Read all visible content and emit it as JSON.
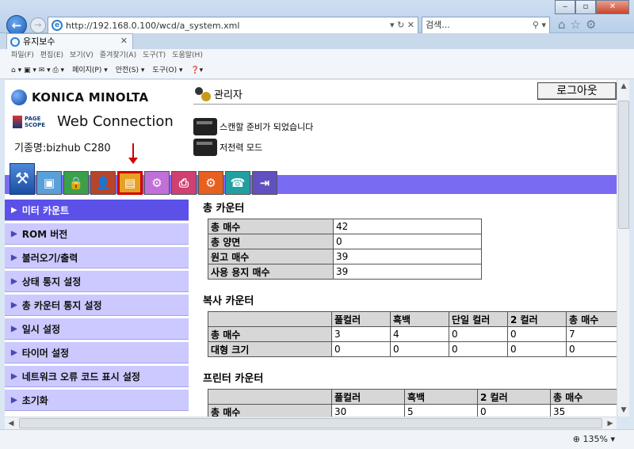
{
  "browser": {
    "url": "http://192.168.0.100/wcd/a_system.xml",
    "search_placeholder": "검색...",
    "tab_title": "유지보수",
    "menus": [
      "파일(F)",
      "편집(E)",
      "보기(V)",
      "즐겨찾기(A)",
      "도구(T)",
      "도움말(H)"
    ],
    "commands": [
      "페이지(P) ▾",
      "안전(S) ▾",
      "도구(O) ▾"
    ],
    "zoom": "135%"
  },
  "header": {
    "brand": "KONICA MINOLTA",
    "product_badge_top": "PAGE",
    "product_badge_bottom": "SCOPE",
    "product": "Web Connection",
    "model": "기종명:bizhub C280",
    "user": "관리자",
    "logout": "로그아웃",
    "status_scan": "스캔할 준비가 되었습니다",
    "status_power": "저전력 모드"
  },
  "icon_tabs": [
    {
      "name": "box",
      "color": "#5aa0d8",
      "glyph": "▣"
    },
    {
      "name": "security",
      "color": "#3aa04a",
      "glyph": "🔒"
    },
    {
      "name": "user-auth",
      "color": "#b8442a",
      "glyph": "👤"
    },
    {
      "name": "maintenance",
      "color": "#e8a020",
      "glyph": "▤"
    },
    {
      "name": "system-settings",
      "color": "#c070d8",
      "glyph": "⚙"
    },
    {
      "name": "print-settings",
      "color": "#d04070",
      "glyph": "⎙"
    },
    {
      "name": "network",
      "color": "#e86020",
      "glyph": "⚙"
    },
    {
      "name": "store-address",
      "color": "#20a0a0",
      "glyph": "☎"
    },
    {
      "name": "fax-settings",
      "color": "#6050c0",
      "glyph": "⇥"
    }
  ],
  "menu": [
    {
      "label": "미터 카운트",
      "active": true
    },
    {
      "label": "ROM 버전",
      "active": false
    },
    {
      "label": "불러오기/출력",
      "active": false
    },
    {
      "label": "상태 통지 설정",
      "active": false
    },
    {
      "label": "총 카운터 통지 설정",
      "active": false
    },
    {
      "label": "일시 설정",
      "active": false
    },
    {
      "label": "타이머 설정",
      "active": false
    },
    {
      "label": "네트워크 오류 코드 표시 설정",
      "active": false
    },
    {
      "label": "초기화",
      "active": false
    }
  ],
  "total_counter": {
    "title": "총 카운터",
    "rows": [
      {
        "label": "총 매수",
        "value": "42"
      },
      {
        "label": "총 양면",
        "value": "0"
      },
      {
        "label": "원고 매수",
        "value": "39"
      },
      {
        "label": "사용 용지 매수",
        "value": "39"
      }
    ]
  },
  "copy_counter": {
    "title": "복사 카운터",
    "headers": [
      "풀컬러",
      "흑백",
      "단일 컬러",
      "2 컬러",
      "총 매수"
    ],
    "rows": [
      {
        "label": "총 매수",
        "values": [
          "3",
          "4",
          "0",
          "0",
          "7"
        ]
      },
      {
        "label": "대형 크기",
        "values": [
          "0",
          "0",
          "0",
          "0",
          "0"
        ]
      }
    ]
  },
  "printer_counter": {
    "title": "프린터 카운터",
    "headers": [
      "풀컬러",
      "흑백",
      "2 컬러",
      "총 매수"
    ],
    "rows": [
      {
        "label": "총 매수",
        "values": [
          "30",
          "5",
          "0",
          "35"
        ]
      }
    ]
  }
}
